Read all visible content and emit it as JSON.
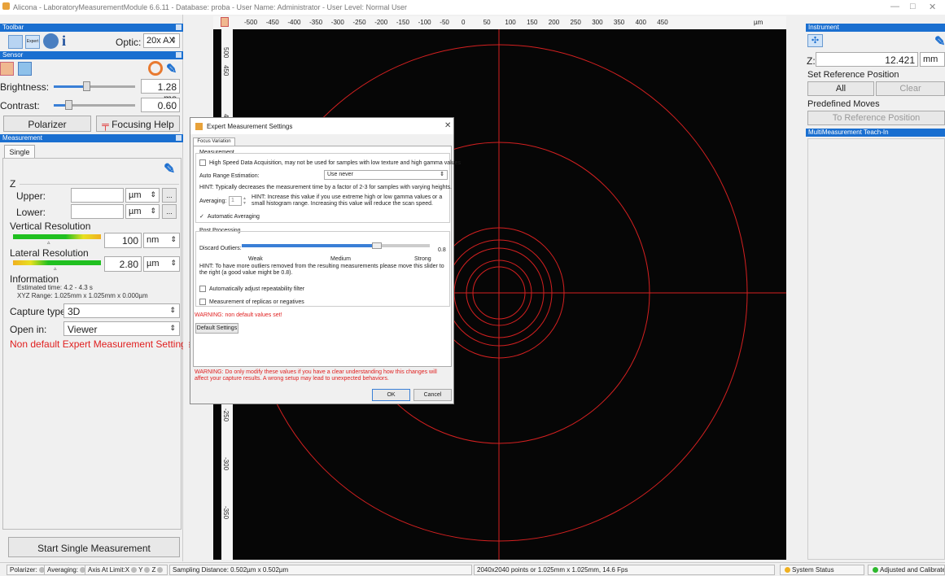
{
  "window": {
    "title": "Alicona - LaboratoryMeasurementModule 6.6.11 - Database: proba - User Name: Administrator - User Level: Normal User",
    "minimize": "—",
    "maximize": "□",
    "close": "✕"
  },
  "toolbar": {
    "header": "Toolbar",
    "expert_label": "Expert",
    "optic_label": "Optic:",
    "optic_value": "20x AX"
  },
  "sensor": {
    "header": "Sensor",
    "brightness_label": "Brightness:",
    "brightness_value": "1.28 ms",
    "contrast_label": "Contrast:",
    "contrast_value": "0.60",
    "polarizer_button": "Polarizer",
    "focusing_help_button": "Focusing Help"
  },
  "measurement": {
    "header": "Measurement",
    "tab_single": "Single",
    "z_label": "Z",
    "upper_label": "Upper:",
    "lower_label": "Lower:",
    "unit_um": "µm",
    "dots": "...",
    "vertical_resolution_label": "Vertical Resolution",
    "vertical_resolution_value": "100",
    "vertical_resolution_unit": "nm",
    "lateral_resolution_label": "Lateral Resolution",
    "lateral_resolution_value": "2.80",
    "lateral_resolution_unit": "µm",
    "information_label": "Information",
    "estimated_time": "Estimated time:  4.2 - 4.3 s",
    "xyz_range": "XYZ Range: 1.025mm x 1.025mm x 0.000µm",
    "capture_type_label": "Capture type:",
    "capture_type_value": "3D",
    "open_in_label": "Open in:",
    "open_in_value": "Viewer",
    "warning": "Non default Expert Measurement Settings!",
    "start_button": "Start Single Measurement"
  },
  "ruler": {
    "top_ticks": [
      "-500",
      "-450",
      "-400",
      "-350",
      "-300",
      "-250",
      "-200",
      "-150",
      "-100",
      "-50",
      "0",
      "50",
      "100",
      "150",
      "200",
      "250",
      "300",
      "350",
      "400",
      "450"
    ],
    "top_unit": "µm",
    "left_ticks": [
      "500",
      "450",
      "400",
      "350",
      "-250",
      "-300",
      "-350",
      "-400",
      "-450",
      "-500"
    ],
    "left_unit": "µm"
  },
  "dialog": {
    "title": "Expert Measurement Settings",
    "tab": "Focus Variation",
    "measurement_group": "Measurement",
    "high_speed": "High Speed Data Acquisition, may not be used for samples with low texture and high gamma values",
    "auto_range_label": "Auto Range Estimation:",
    "auto_range_value": "Use never",
    "hint1": "HINT: Typically decreases the measurement time  by a factor of 2-3 for samples with varying heights.",
    "averaging_label": "Averaging:",
    "averaging_value": "1",
    "hint2": "HINT: Increase this value if you use extreme high or low gamma values or a small histogram range. Increasing this value will reduce the scan speed.",
    "auto_averaging": "Automatic Averaging",
    "post_processing_group": "Post Processing",
    "discard_outliers_label": "Discard Outliers:",
    "discard_outliers_value": "0.8",
    "discard_outliers_level": 0.72,
    "weak": "Weak",
    "medium": "Medium",
    "strong": "Strong",
    "hint3": "HINT: To have more outliers removed from the resulting measurements please move this slider to the right (a good value might be 0.8).",
    "repeatability": "Automatically adjust repeatability filter",
    "replicas": "Measurement of replicas or negatives",
    "warning_nondefault": "WARNING: non default values set!",
    "default_settings_button": "Default Settings",
    "warning_modify": "WARNING: Do only modify these values if you have a clear understanding how this changes will affect your capture results. A wrong setup may lead to unexpected behaviors.",
    "ok": "OK",
    "cancel": "Cancel"
  },
  "instrument": {
    "header": "Instrument",
    "z_label": "Z:",
    "z_value": "12.421",
    "z_unit": "mm",
    "set_ref_label": "Set Reference Position",
    "all_button": "All",
    "clear_button": "Clear",
    "predefined_moves": "Predefined Moves",
    "to_reference": "To Reference Position",
    "teach_in_header": "MultiMeasurement Teach-In"
  },
  "status": {
    "polarizer": "Polarizer:",
    "averaging": "Averaging:",
    "axis_limit": "Axis At Limit:X",
    "y": "Y",
    "z": "Z",
    "sampling": "Sampling Distance: 0.502µm x 0.502µm",
    "points": "2040x2040 points or 1.025mm x 1.025mm, 14.6 Fps",
    "system_status": "System Status",
    "calibrated": "Adjusted and Calibrated"
  },
  "colors": {
    "accent": "#1a6fd0",
    "warning": "#e02020",
    "overlay": "#d42020"
  }
}
